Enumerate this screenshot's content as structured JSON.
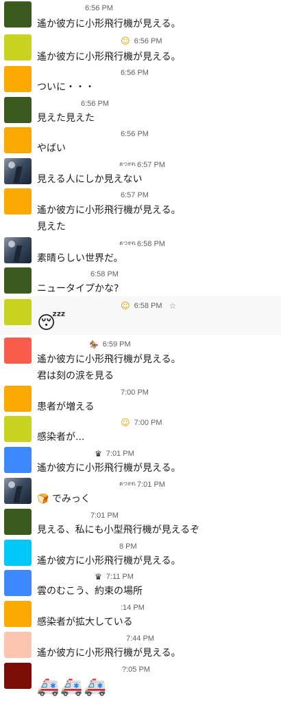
{
  "messages": [
    {
      "avatar_color": "#3a5a1e",
      "time": "6:56 PM",
      "text": "遙か彼方に小形飛行機が見える。"
    },
    {
      "avatar_color": "#c7d31f",
      "status_icon": "smile-emoji",
      "time": "6:56 PM",
      "text": "遙か彼方に小形飛行機が見える。"
    },
    {
      "avatar_color": "#fca902",
      "time": "6:56 PM",
      "text": "ついに・・・"
    },
    {
      "avatar_color": "#3a5a1e",
      "time": "6:56 PM",
      "text": "見えた見えた"
    },
    {
      "avatar_color": "#fca902",
      "time": "6:56 PM",
      "text": "やばい"
    },
    {
      "avatar": "photo",
      "status_text": "おつかれ",
      "time": "6:57 PM",
      "text": "見える人にしか見えない"
    },
    {
      "avatar_color": "#fca902",
      "time": "6:57 PM",
      "text": "遙か彼方に小形飛行機が見える。",
      "continuation": "見えた"
    },
    {
      "avatar": "photo",
      "status_text": "おつかれ",
      "time": "6:58 PM",
      "text": "素晴らしい世界だ。"
    },
    {
      "avatar_color": "#3a5a1e",
      "time": "6:58 PM",
      "text": "ニュータイプかな?"
    },
    {
      "avatar_color": "#c7d31f",
      "status_icon": "smile-emoji",
      "time": "6:58 PM",
      "text": "😴",
      "highlighted": true
    },
    {
      "avatar_color": "#f85d4c",
      "status_icon": "horse-racing-emoji",
      "time": "6:59 PM",
      "text": "遙か彼方に小形飛行機が見える。",
      "continuation": "君は刻の涙を見る"
    },
    {
      "avatar_color": "#fca902",
      "time": "7:00 PM",
      "text": "患者が増える"
    },
    {
      "avatar_color": "#c7d31f",
      "status_icon": "smile-emoji",
      "time": "7:00 PM",
      "text": "感染者が..."
    },
    {
      "avatar_color": "#3d88fc",
      "status_icon": "vader-emoji",
      "time": "7:01 PM",
      "text": "遙か彼方に小形飛行機が見える。"
    },
    {
      "avatar": "photo",
      "status_text": "おつかれ",
      "time": "7:01 PM",
      "text": "🍞 でみっく"
    },
    {
      "avatar_color": "#3a5a1e",
      "time": "7:01 PM",
      "text": "見える、私にも小型飛行機が見えるぞ"
    },
    {
      "avatar_color": "#00c8f8",
      "time": "8 PM",
      "text": "遙か彼方に小形飛行機が見える。"
    },
    {
      "avatar_color": "#3d88fc",
      "status_icon": "vader-emoji",
      "time": "7:11 PM",
      "text": "雲のむこう、約束の場所"
    },
    {
      "avatar_color": "#fca902",
      "time": ":14 PM",
      "text": "感染者が拡大している"
    },
    {
      "avatar_color": "#fdc4b0",
      "time": "7:44 PM",
      "text": "遙か彼方に小形飛行機が見える。"
    },
    {
      "avatar_color": "#7a0e06",
      "time": "?:05 PM",
      "text": "🚑🚑🚑"
    }
  ]
}
